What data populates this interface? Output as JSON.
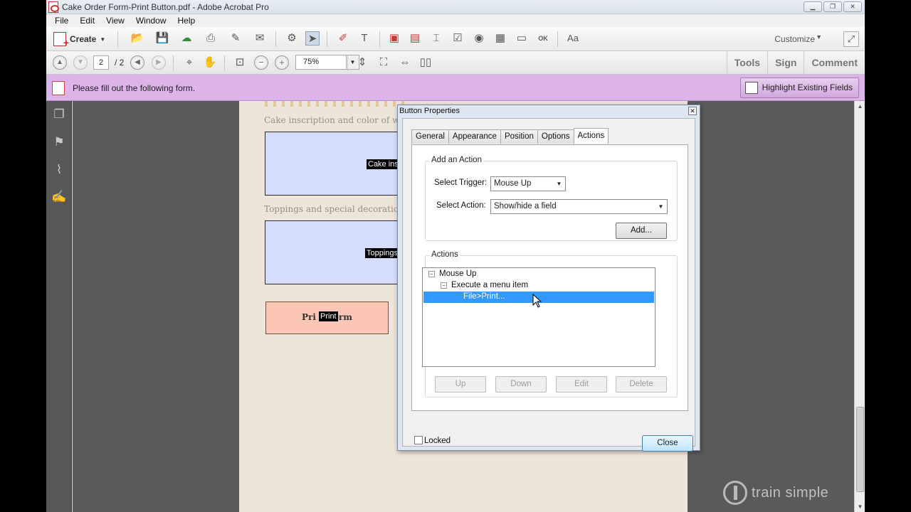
{
  "window": {
    "title": "Cake Order Form-Print Button.pdf - Adobe Acrobat Pro"
  },
  "menu": [
    "File",
    "Edit",
    "View",
    "Window",
    "Help"
  ],
  "toolbar": {
    "create_label": "Create",
    "customize_label": "Customize"
  },
  "nav": {
    "page_current": "2",
    "page_total": "/ 2",
    "zoom": "75%"
  },
  "panes": [
    "Tools",
    "Sign",
    "Comment"
  ],
  "formbar": {
    "message": "Please fill out the following form.",
    "highlight_label": "Highlight Existing Fields"
  },
  "document": {
    "label_inscription": "Cake inscription and color of writ",
    "field_inscription_tag": "Cake insc",
    "label_toppings": "Toppings and special decoration r",
    "field_toppings_tag": "Toppings",
    "print_button_text_left": "Pri",
    "print_button_tag": "Print",
    "print_button_text_right": "orm"
  },
  "dialog": {
    "title": "Button Properties",
    "tabs": [
      "General",
      "Appearance",
      "Position",
      "Options",
      "Actions"
    ],
    "active_tab": "Actions",
    "add_action_group": "Add an Action",
    "select_trigger_label": "Select Trigger:",
    "select_trigger_value": "Mouse Up",
    "select_action_label": "Select Action:",
    "select_action_value": "Show/hide a field",
    "add_button": "Add...",
    "actions_group": "Actions",
    "tree": {
      "root": "Mouse Up",
      "child": "Execute a menu item",
      "selected": "File>Print..."
    },
    "buttons": {
      "up": "Up",
      "down": "Down",
      "edit": "Edit",
      "delete": "Delete"
    },
    "locked_label": "Locked",
    "close_button": "Close"
  },
  "watermark": "train simple",
  "colors": {
    "form_bar": "#dcb4ea",
    "selection": "#3399ff",
    "field_fill": "#d6dcfb",
    "print_fill": "#fbc6b6"
  }
}
